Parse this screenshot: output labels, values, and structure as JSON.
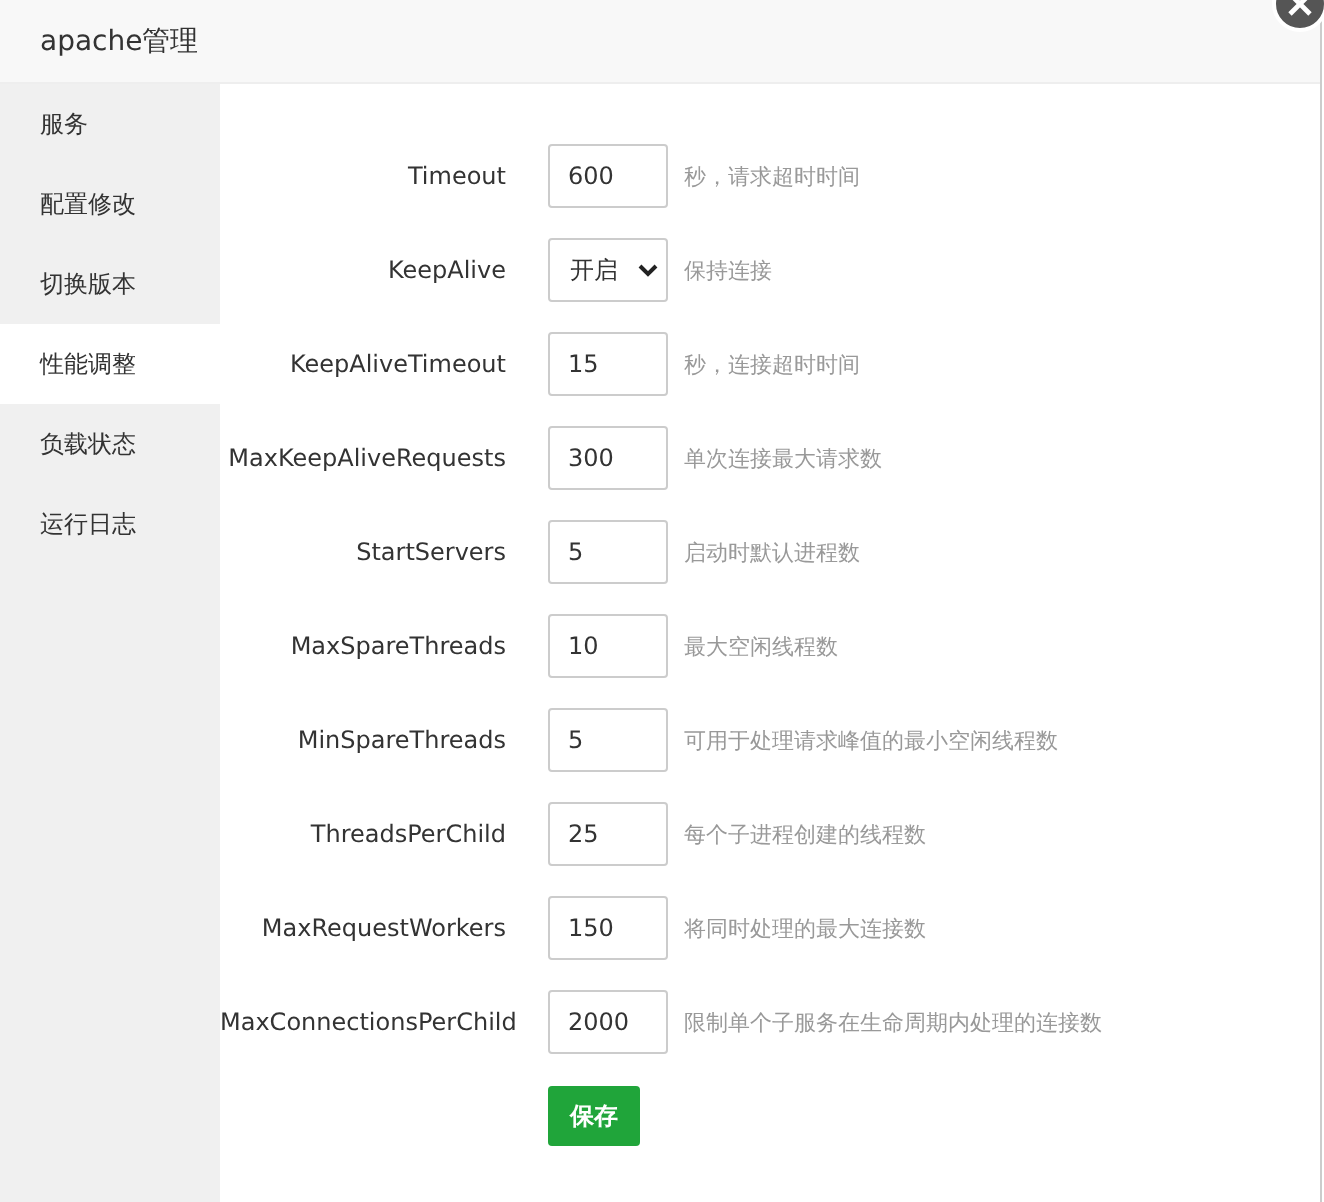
{
  "window": {
    "title": "apache管理"
  },
  "sidebar": {
    "items": [
      {
        "label": "服务",
        "selected": false
      },
      {
        "label": "配置修改",
        "selected": false
      },
      {
        "label": "切换版本",
        "selected": false
      },
      {
        "label": "性能调整",
        "selected": true
      },
      {
        "label": "负载状态",
        "selected": false
      },
      {
        "label": "运行日志",
        "selected": false
      }
    ]
  },
  "form": {
    "rows": [
      {
        "kind": "input",
        "label": "Timeout",
        "value": "600",
        "hint": "秒，请求超时时间"
      },
      {
        "kind": "select",
        "label": "KeepAlive",
        "value": "开启",
        "hint": "保持连接"
      },
      {
        "kind": "input",
        "label": "KeepAliveTimeout",
        "value": "15",
        "hint": "秒，连接超时时间"
      },
      {
        "kind": "input",
        "label": "MaxKeepAliveRequests",
        "value": "300",
        "hint": "单次连接最大请求数"
      },
      {
        "kind": "input",
        "label": "StartServers",
        "value": "5",
        "hint": "启动时默认进程数"
      },
      {
        "kind": "input",
        "label": "MaxSpareThreads",
        "value": "10",
        "hint": "最大空闲线程数"
      },
      {
        "kind": "input",
        "label": "MinSpareThreads",
        "value": "5",
        "hint": "可用于处理请求峰值的最小空闲线程数"
      },
      {
        "kind": "input",
        "label": "ThreadsPerChild",
        "value": "25",
        "hint": "每个子进程创建的线程数"
      },
      {
        "kind": "input",
        "label": "MaxRequestWorkers",
        "value": "150",
        "hint": "将同时处理的最大连接数"
      },
      {
        "kind": "input",
        "label": "MaxConnectionsPerChild",
        "value": "2000",
        "hint": "限制单个子服务在生命周期内处理的连接数"
      }
    ],
    "save_button": "保存"
  }
}
